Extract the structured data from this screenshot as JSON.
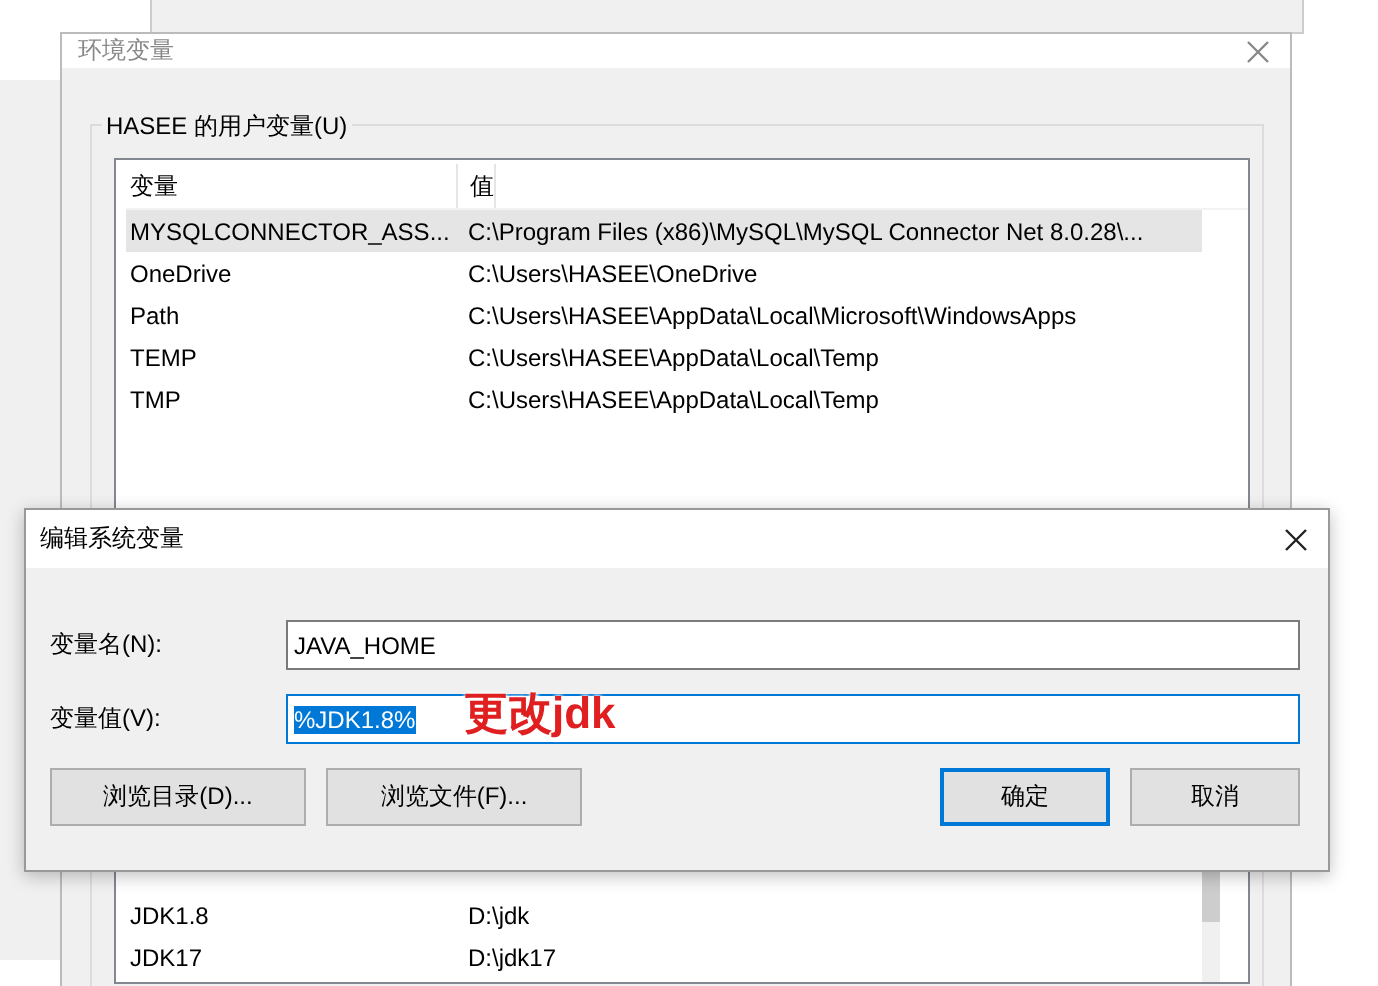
{
  "env_window": {
    "title": "环境变量",
    "user_group": {
      "label": "HASEE 的用户变量(U)",
      "columns": [
        "变量",
        "值"
      ],
      "rows": [
        {
          "name": "MYSQLCONNECTOR_ASS...",
          "value": "C:\\Program Files (x86)\\MySQL\\MySQL Connector Net 8.0.28\\...",
          "selected": true
        },
        {
          "name": "OneDrive",
          "value": "C:\\Users\\HASEE\\OneDrive",
          "selected": false
        },
        {
          "name": "Path",
          "value": "C:\\Users\\HASEE\\AppData\\Local\\Microsoft\\WindowsApps",
          "selected": false
        },
        {
          "name": "TEMP",
          "value": "C:\\Users\\HASEE\\AppData\\Local\\Temp",
          "selected": false
        },
        {
          "name": "TMP",
          "value": "C:\\Users\\HASEE\\AppData\\Local\\Temp",
          "selected": false
        }
      ]
    },
    "system_rows": [
      {
        "name": "JDK1.8",
        "value": "D:\\jdk"
      },
      {
        "name": "JDK17",
        "value": "D:\\jdk17"
      }
    ]
  },
  "edit_dialog": {
    "title": "编辑系统变量",
    "fields": [
      {
        "label": "变量名(N):",
        "value": "JAVA_HOME",
        "focused": false
      },
      {
        "label": "变量值(V):",
        "value": "%JDK1.8%",
        "focused": true
      }
    ],
    "annotation": "更改jdk",
    "buttons": [
      {
        "label": "浏览目录(D)...",
        "default": false
      },
      {
        "label": "浏览文件(F)...",
        "default": false
      },
      {
        "label": "确定",
        "default": true
      },
      {
        "label": "取消",
        "default": false
      }
    ]
  }
}
